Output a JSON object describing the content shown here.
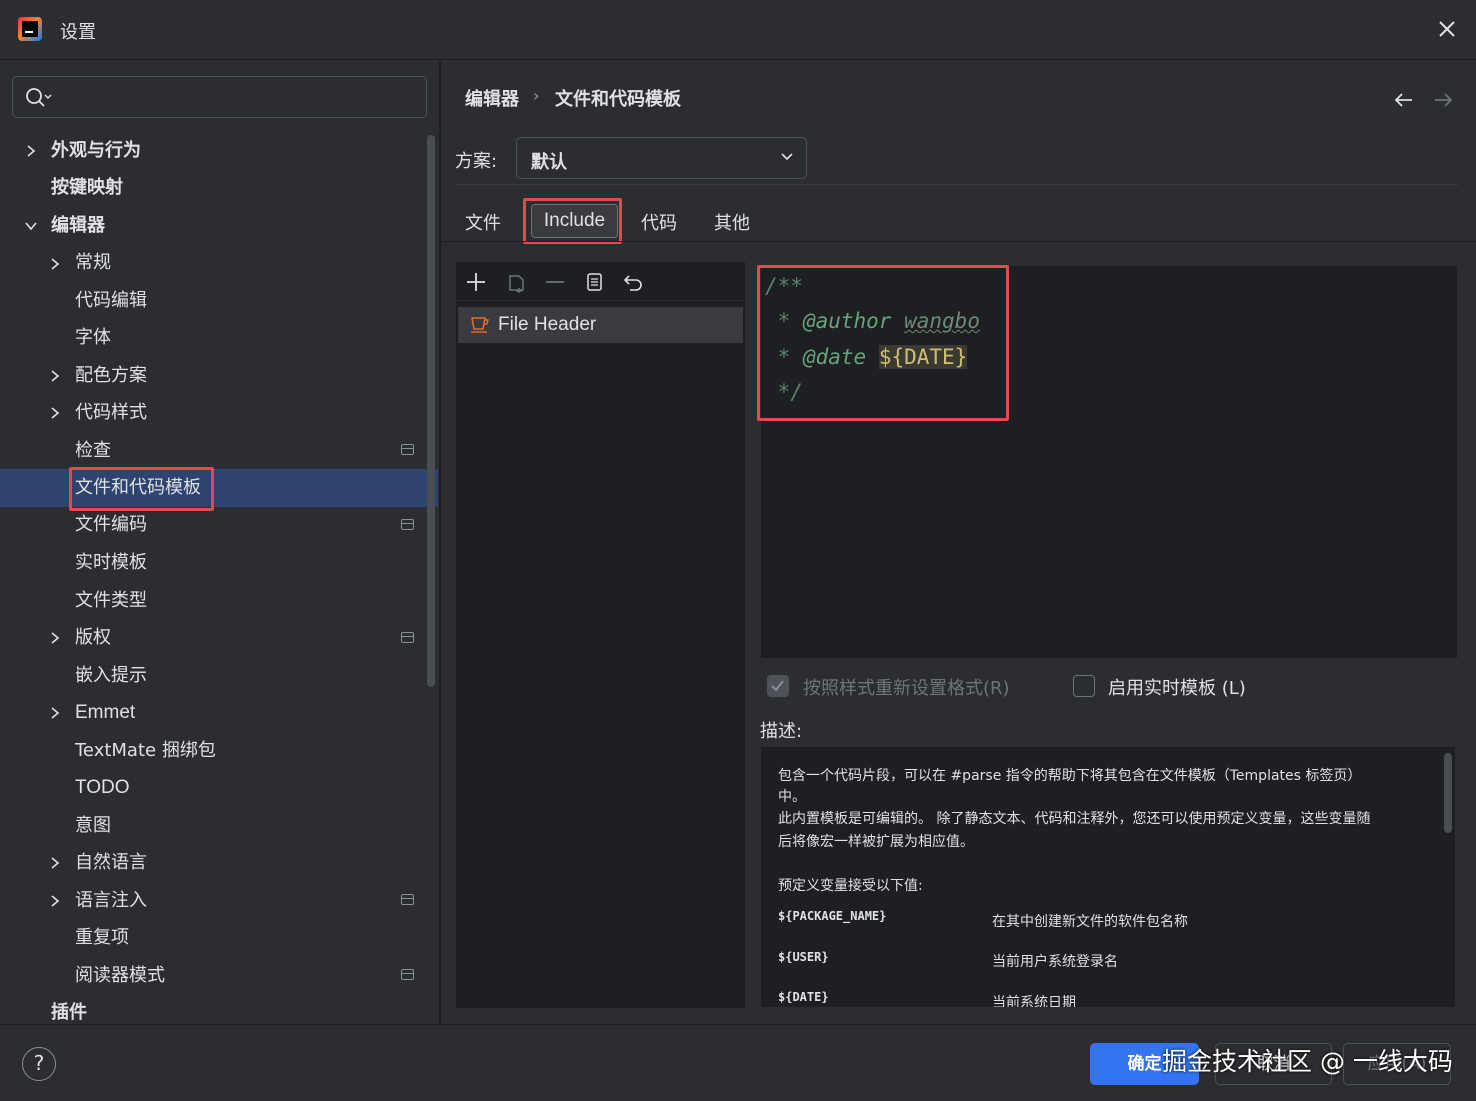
{
  "window": {
    "title": "设置"
  },
  "sidebar": {
    "search_placeholder": "",
    "items": [
      {
        "label": "外观与行为",
        "bold": true,
        "chevron": "right"
      },
      {
        "label": "按键映射",
        "bold": true
      },
      {
        "label": "编辑器",
        "bold": true,
        "chevron": "down"
      },
      {
        "label": "常规",
        "chevron": "right"
      },
      {
        "label": "代码编辑"
      },
      {
        "label": "字体"
      },
      {
        "label": "配色方案",
        "chevron": "right"
      },
      {
        "label": "代码样式",
        "chevron": "right"
      },
      {
        "label": "检查",
        "project_icon": true
      },
      {
        "label": "文件和代码模板",
        "selected": true
      },
      {
        "label": "文件编码",
        "project_icon": true
      },
      {
        "label": "实时模板"
      },
      {
        "label": "文件类型"
      },
      {
        "label": "版权",
        "chevron": "right",
        "project_icon": true
      },
      {
        "label": "嵌入提示"
      },
      {
        "label": "Emmet",
        "chevron": "right"
      },
      {
        "label": "TextMate 捆绑包"
      },
      {
        "label": "TODO"
      },
      {
        "label": "意图"
      },
      {
        "label": "自然语言",
        "chevron": "right"
      },
      {
        "label": "语言注入",
        "chevron": "right",
        "project_icon": true
      },
      {
        "label": "重复项"
      },
      {
        "label": "阅读器模式",
        "project_icon": true
      },
      {
        "label": "插件",
        "bold": true
      }
    ]
  },
  "breadcrumb": {
    "parent": "编辑器",
    "separator": "›",
    "current": "文件和代码模板"
  },
  "scheme": {
    "label": "方案:",
    "value": "默认"
  },
  "tabs": [
    {
      "label": "文件"
    },
    {
      "label": "Include",
      "active": true
    },
    {
      "label": "代码"
    },
    {
      "label": "其他"
    }
  ],
  "template_list": {
    "toolbar": [
      "add-icon",
      "copy-icon",
      "remove-icon",
      "duplicate-icon",
      "reset-icon"
    ],
    "items": [
      {
        "label": "File Header",
        "icon": "cup-icon"
      }
    ]
  },
  "editor": {
    "line1": "/**",
    "line2_star": " * ",
    "line2_tag": "@author",
    "line2_space": " ",
    "line2_value": "wangbo",
    "line3_star": " * ",
    "line3_tag": "@date",
    "line3_space": " ",
    "line3_var": "${DATE}",
    "line4": " */"
  },
  "options": {
    "reformat_label": "按照样式重新设置格式(R)",
    "reformat_checked": true,
    "live_templates_label": "启用实时模板 (L)",
    "live_templates_checked": false
  },
  "description": {
    "label": "描述:",
    "line1": "包含一个代码片段，可以在 #parse 指令的帮助下将其包含在文件模板（Templates 标签页）",
    "line2": "中。",
    "line3": "此内置模板是可编辑的。 除了静态文本、代码和注释外，您还可以使用预定义变量，这些变量随",
    "line4": "后将像宏一样被扩展为相应值。",
    "vars_intro": "预定义变量接受以下值:",
    "vars": [
      {
        "name": "${PACKAGE_NAME}",
        "desc": "在其中创建新文件的软件包名称"
      },
      {
        "name": "${USER}",
        "desc": "当前用户系统登录名"
      },
      {
        "name": "${DATE}",
        "desc": "当前系统日期"
      }
    ]
  },
  "footer": {
    "help": "?",
    "ok": "确定",
    "cancel": "取消",
    "apply": "应用(A)",
    "watermark": "掘金技术社区 @ 一线大码"
  },
  "colors": {
    "accent": "#3574f0",
    "selection": "#2e436e",
    "highlight_box": "#e5484d",
    "background": "#2b2d30"
  }
}
